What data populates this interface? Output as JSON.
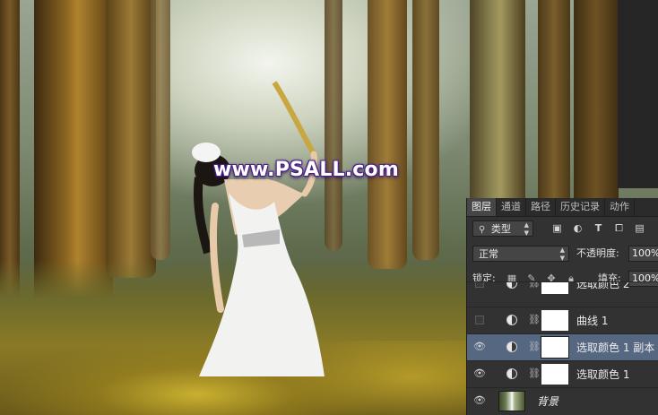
{
  "canvas": {
    "watermark": "www.PSALL.com"
  },
  "layers_panel": {
    "tabs": [
      {
        "label": "图层",
        "active": true
      },
      {
        "label": "通道",
        "active": false
      },
      {
        "label": "路径",
        "active": false
      },
      {
        "label": "历史记录",
        "active": false
      },
      {
        "label": "动作",
        "active": false
      }
    ],
    "filter": {
      "label": "类型",
      "icons": [
        "image-filter-icon",
        "adjustment-filter-icon",
        "type-filter-icon",
        "shape-filter-icon",
        "smart-object-filter-icon"
      ]
    },
    "blend": {
      "mode": "正常",
      "opacity_label": "不透明度:",
      "opacity_value": "100%"
    },
    "lock": {
      "label": "锁定:",
      "fill_label": "填充:",
      "fill_value": "100%"
    },
    "layers": [
      {
        "name": "选取颜色 2",
        "visible": false,
        "selected": false
      },
      {
        "name": "曲线 1",
        "visible": false,
        "selected": false
      },
      {
        "name": "选取颜色 1 副本",
        "visible": true,
        "selected": true
      },
      {
        "name": "选取颜色 1",
        "visible": true,
        "selected": false
      },
      {
        "name": "背景",
        "visible": true,
        "selected": false
      }
    ]
  },
  "colors": {
    "panel_bg": "#323232",
    "selected_layer": "#566782",
    "watermark_outline": "#4a1f8a"
  }
}
